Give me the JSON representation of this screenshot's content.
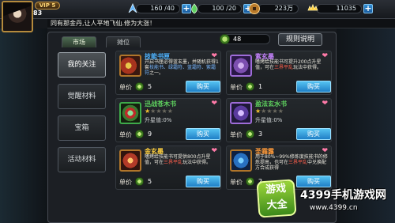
{
  "player": {
    "vip": "VIP 5",
    "level": "83"
  },
  "resources": [
    {
      "name": "stamina",
      "value": "160 /40",
      "icon": "stamina-icon"
    },
    {
      "name": "energy",
      "value": "100 /20",
      "icon": "energy-icon"
    },
    {
      "name": "copper",
      "value": "223万",
      "icon": "coin-icon"
    },
    {
      "name": "gold",
      "value": "11035",
      "icon": "gold-ingot-icon"
    }
  ],
  "marquee": "同有那金丹,让人平地飞仙.修为大涨！",
  "tabs": [
    {
      "label": "市场"
    },
    {
      "label": "摊位"
    }
  ],
  "currency": {
    "value": "48"
  },
  "rules_button": "规则说明",
  "side_nav": [
    {
      "label": "我的关注"
    },
    {
      "label": "觉醒材料"
    },
    {
      "label": "宝箱"
    },
    {
      "label": "活动材料"
    }
  ],
  "price_label": "单价",
  "buy_label": "购买",
  "items": [
    {
      "name": "技能书匣",
      "name_color": "#4db3ff",
      "desc_a": "开启书匣必得蓝玄墨，并随机获得1套",
      "desc_b": "技能书、绿霜符、蓝霜符、紫霜符",
      "desc_c": "之一。",
      "price": "5"
    },
    {
      "name": "紫玄墨",
      "name_color": "#c784ff",
      "desc_a": "嗜烤给技能书可提升200点升星值，可在",
      "desc_b": "三界平乱",
      "desc_c": "玩法中获得。",
      "price": "1"
    },
    {
      "name": "迅战苍木书",
      "name_color": "#5fd35f",
      "stars": "★",
      "stars_dim": "★★★★",
      "upgrade": "升星值:0%",
      "price": "9"
    },
    {
      "name": "盈法玄水书",
      "name_color": "#5fd35f",
      "stars": "★",
      "stars_dim": "★★★★",
      "upgrade": "升星值:0%",
      "price": "3"
    },
    {
      "name": "金玄墨",
      "name_color": "#ffd040",
      "desc_a": "嗜烤给技能书可提供800点升星值，可在",
      "desc_b": "三界平乱",
      "desc_c": "玩法中获得。",
      "price": "5"
    },
    {
      "name": "圣霜露",
      "name_color": "#ff9a3a",
      "desc_a": "用于80%~99%修炼度技能书的修炼提高，也可在",
      "desc_b": "三界平乱",
      "desc_c": "中兑换配方合成获得",
      "price": "2"
    }
  ],
  "watermark": {
    "logo_top": "游戏",
    "logo_bottom": "大全",
    "site": "4399手机游戏网",
    "url": "www.4399.cn"
  }
}
